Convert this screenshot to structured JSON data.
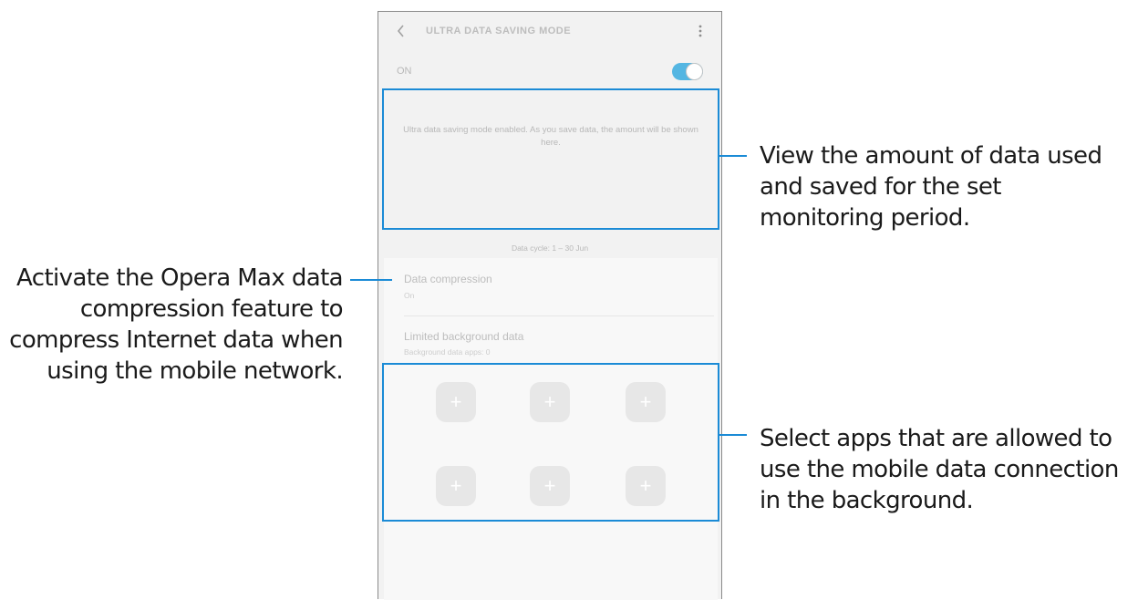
{
  "app_bar": {
    "title": "ULTRA DATA SAVING MODE",
    "back_icon": "chevron-left-icon",
    "more_icon": "more-vertical-icon"
  },
  "master_switch": {
    "label": "ON",
    "state": "on",
    "accent": "#54b6e2"
  },
  "usage_message": "Ultra data saving mode enabled. As you save data, the amount will be shown here.",
  "data_cycle": "Data cycle: 1 – 30 Jun",
  "settings": [
    {
      "title": "Data compression",
      "subtitle": "On"
    },
    {
      "title": "Limited background data",
      "subtitle": "Background data apps: 0"
    }
  ],
  "app_slots": [
    "+",
    "+",
    "+",
    "+",
    "+",
    "+"
  ],
  "callouts": {
    "usage": "View the amount of data used and saved for the set monitoring period.",
    "compression": "Activate the Opera Max data compression feature to compress Internet data when using the mobile network.",
    "background": "Select apps that are allowed to use the mobile data connection in the background.",
    "color": "#1b8bd6"
  }
}
